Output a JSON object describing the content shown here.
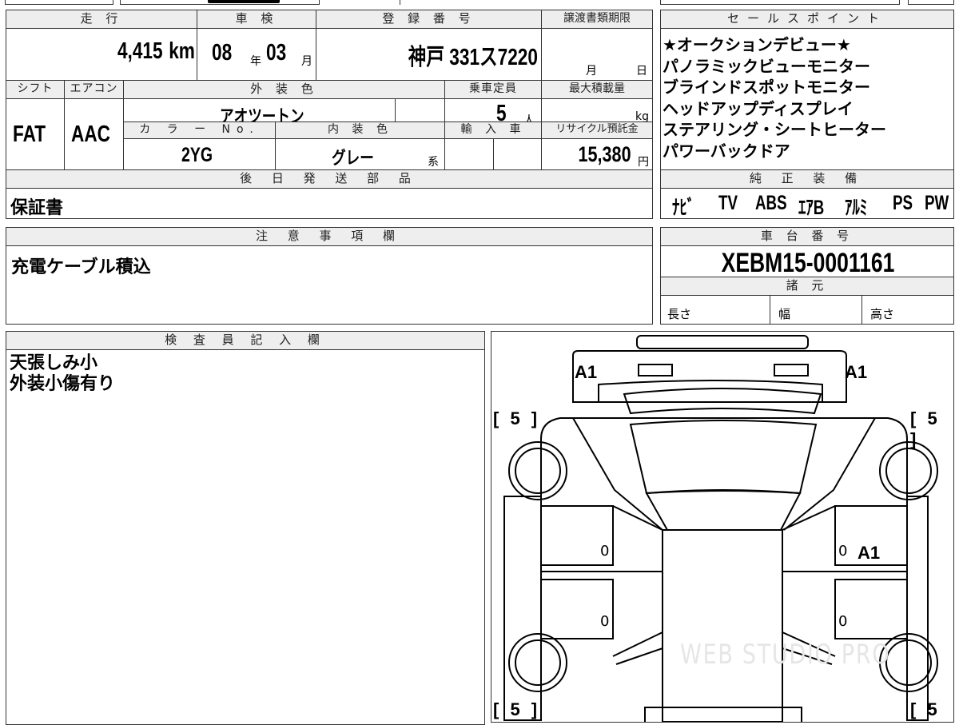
{
  "top": {
    "mileage_label": "走 行",
    "mileage_value": "4,415",
    "mileage_unit": "km",
    "shaken_label": "車 検",
    "shaken_year": "08",
    "shaken_year_unit": "年",
    "shaken_month": "03",
    "shaken_month_unit": "月",
    "plate_label": "登 録 番 号",
    "plate_value": "神戸 331ス7220",
    "transfer_label": "譲渡書類期限",
    "transfer_month_unit": "月",
    "transfer_day_unit": "日"
  },
  "row2": {
    "shift_label": "シフト",
    "aircon_label": "エアコン",
    "exterior_label": "外 装 色",
    "capacity_label": "乗車定員",
    "maxload_label": "最大積載量",
    "shift_value": "FAT",
    "aircon_value": "AAC",
    "exterior_value": "アオツートン",
    "capacity_value": "5",
    "capacity_unit": "人",
    "maxload_unit": "kg",
    "colorno_label": "カ ラ ー No.",
    "interior_label": "内 装 色",
    "import_label": "輸 入 車",
    "recycle_label": "リサイクル預託金",
    "colorno_value": "2YG",
    "interior_value": "グレー",
    "interior_unit": "系",
    "recycle_value": "15,380",
    "recycle_unit": "円"
  },
  "later_parts": {
    "label": "後 日 発 送 部 品",
    "value": "保証書"
  },
  "sales_points": {
    "label": "セールスポイント",
    "items": [
      "★オークションデビュー★",
      "パノラミックビューモニター",
      "ブラインドスポットモニター",
      "ヘッドアップディスプレイ",
      "ステアリング・シートヒーター",
      "パワーバックドア"
    ]
  },
  "equipment": {
    "label": "純 正 装 備",
    "items": [
      "ﾅﾋﾞ",
      "TV",
      "ABS",
      "ｴｱB",
      "ｱﾙﾐ",
      "PS",
      "PW"
    ]
  },
  "notes": {
    "label": "注 意 事 項 欄",
    "value": "充電ケーブル積込"
  },
  "chassis": {
    "label": "車 台 番 号",
    "value": "XEBM15-0001161",
    "spec_label": "諸 元",
    "length_label": "長さ",
    "width_label": "幅",
    "height_label": "高さ"
  },
  "inspector": {
    "label": "検 査 員 記 入 欄",
    "lines": [
      "天張しみ小",
      "外装小傷有り"
    ]
  },
  "diagram": {
    "marks": {
      "front_left": "A1",
      "front_right": "A1",
      "right_door": "A1"
    },
    "tire_tl": "[ 5 ]",
    "tire_tr": "[ 5 ]",
    "tire_bl": "[ 5 ]",
    "tire_br": "[ 5 ]",
    "zero": "0",
    "watermark": "WEB STUDIO PRO"
  }
}
